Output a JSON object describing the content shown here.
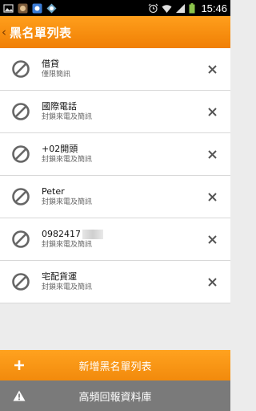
{
  "status_bar": {
    "time": "15:46",
    "icons": [
      "image-icon",
      "app-icon",
      "app-icon",
      "app-icon",
      "alarm-icon",
      "wifi-icon",
      "signal-icon",
      "battery-icon"
    ]
  },
  "header": {
    "title": "黑名單列表",
    "back_icon": "chevron-left-icon"
  },
  "entries": [
    {
      "title": "借貸",
      "subtitle": "僅限簡訊"
    },
    {
      "title": "國際電話",
      "subtitle": "封鎖來電及簡訊"
    },
    {
      "title": "+02開頭",
      "subtitle": "封鎖來電及簡訊"
    },
    {
      "title": "Peter",
      "subtitle": "封鎖來電及簡訊"
    },
    {
      "title": "0982417",
      "subtitle": "封鎖來電及簡訊"
    },
    {
      "title": "宅配貨運",
      "subtitle": "封鎖來電及簡訊"
    }
  ],
  "buttons": {
    "add_label": "新增黑名單列表",
    "report_label": "高頻回報資料庫"
  },
  "colors": {
    "accent": "#f7900f",
    "secondary_button": "#7a7a7a"
  }
}
